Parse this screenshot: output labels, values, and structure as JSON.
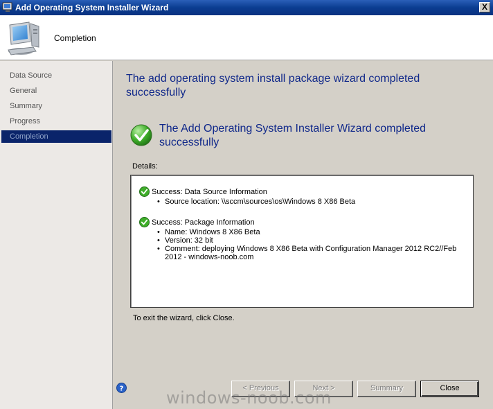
{
  "window": {
    "title": "Add Operating System Installer Wizard",
    "close_glyph": "X"
  },
  "header": {
    "title": "Completion"
  },
  "sidebar": {
    "items": [
      {
        "label": "Data Source"
      },
      {
        "label": "General"
      },
      {
        "label": "Summary"
      },
      {
        "label": "Progress"
      },
      {
        "label": "Completion",
        "active": true
      }
    ]
  },
  "main": {
    "heading": "The add operating system install package wizard completed successfully",
    "result_heading": "The Add Operating System Installer Wizard completed successfully",
    "details_label": "Details:",
    "details": [
      {
        "title": "Success: Data Source Information",
        "items": [
          "Source location: \\\\sccm\\sources\\os\\Windows 8 X86 Beta"
        ]
      },
      {
        "title": "Success: Package Information",
        "items": [
          "Name: Windows 8 X86 Beta",
          "Version: 32 bit",
          "Comment: deploying Windows 8 X86 Beta with Configuration Manager 2012 RC2//Feb 2012 - windows-noob.com"
        ]
      }
    ],
    "exit_text": "To exit the wizard, click Close."
  },
  "buttons": {
    "previous": "< Previous",
    "next": "Next >",
    "summary": "Summary",
    "close": "Close"
  },
  "watermark": "windows-noob.com",
  "colors": {
    "heading": "#10288a",
    "active_nav": "#0a246a",
    "titlebar": "#0b3d91"
  }
}
